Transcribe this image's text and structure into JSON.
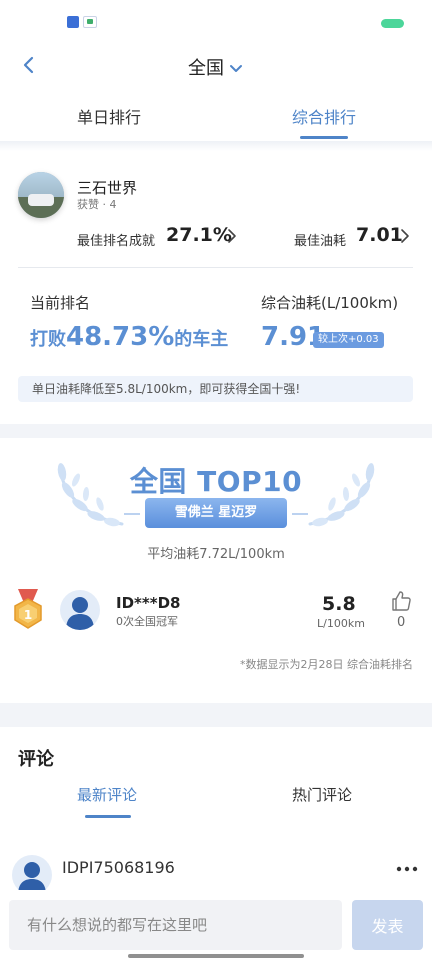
{
  "nav": {
    "title": "全国"
  },
  "tabs": [
    {
      "label": "单日排行",
      "active": false
    },
    {
      "label": "综合排行",
      "active": true
    }
  ],
  "profile": {
    "username": "三石世界",
    "likes": "获赞 · 4",
    "best_rank_label": "最佳排名成就",
    "best_rank_value": "27.1%",
    "best_fuel_label": "最佳油耗",
    "best_fuel_value": "7.01"
  },
  "stats": {
    "current_rank_label": "当前排名",
    "current_rank_prefix": "打败",
    "current_rank_value": "48.73%",
    "current_rank_suffix": "的车主",
    "fuel_label": "综合油耗(L/100km)",
    "fuel_value": "7.91",
    "fuel_delta_badge": "较上次+0.03",
    "tip": "单日油耗降低至5.8L/100km，即可获得全国十强!"
  },
  "top10": {
    "title": "全国 TOP10",
    "car_model": "雪佛兰 星迈罗",
    "avg_fuel": "平均油耗7.72L/100km"
  },
  "champion": {
    "rank_medal": "1",
    "name": "ID***D8",
    "subtitle": "0次全国冠军",
    "fuel_value": "5.8",
    "fuel_unit": "L/100km",
    "like_count": "0"
  },
  "data_note": "*数据显示为2月28日 综合油耗排名",
  "comments": {
    "title": "评论",
    "tabs": [
      {
        "label": "最新评论",
        "active": true
      },
      {
        "label": "热门评论",
        "active": false
      }
    ],
    "items": [
      {
        "username": "IDPI75068196"
      }
    ]
  },
  "bottom_bar": {
    "input_placeholder": "有什么想说的都写在这里吧",
    "send_label": "发表"
  },
  "colors": {
    "accent": "#4e84c8",
    "highlight": "#5b8fd3",
    "badge": "#6b9be0",
    "medal_gold": "#f2b648",
    "send_disabled": "#c7d6ee"
  }
}
